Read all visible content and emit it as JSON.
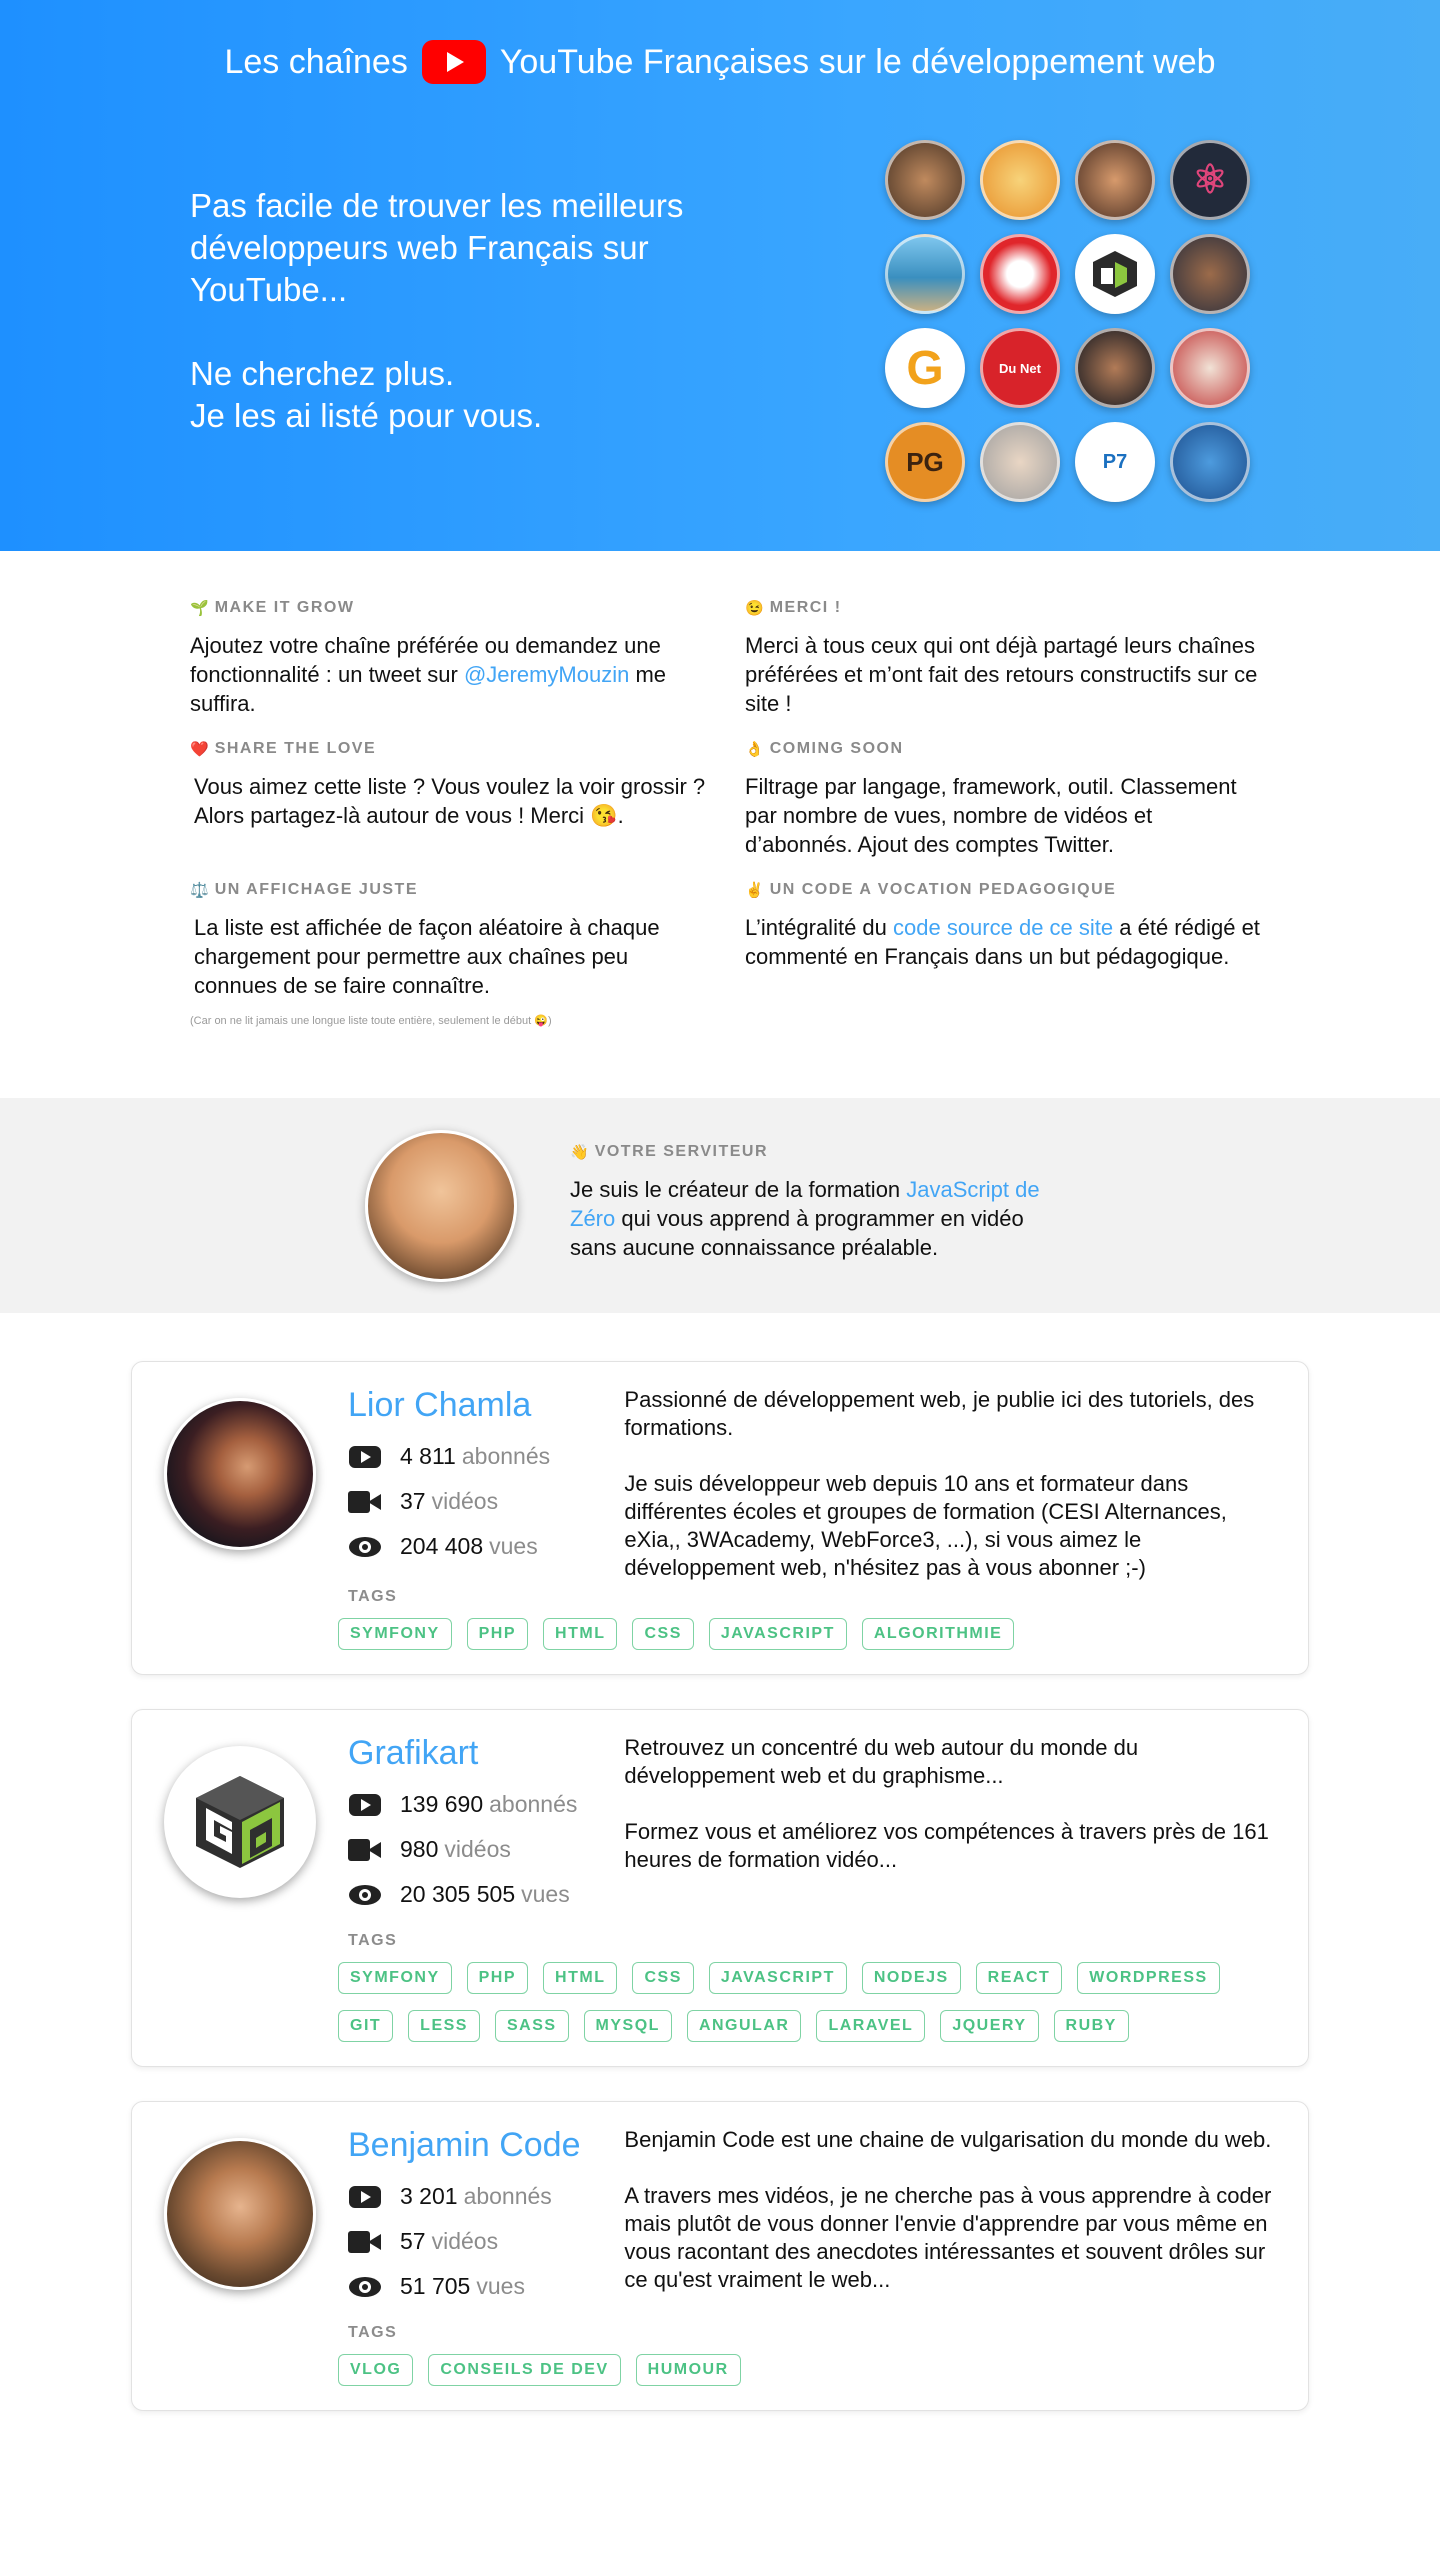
{
  "hero": {
    "title_before": "Les chaînes",
    "title_after": "YouTube Françaises sur le développement web",
    "text_1": "Pas facile de trouver les meilleurs développeurs web Français sur YouTube...",
    "text_2_line1": "Ne cherchez plus.",
    "text_2_line2": "Je les ai listé pour vous.",
    "avatars": [
      "LC",
      "Y",
      "BC",
      "React",
      "Voyage",
      "WC",
      "Grafikart",
      "Fam",
      "G",
      "Du Net",
      "DR",
      "Kid",
      "PG",
      "T",
      "PrimFX",
      "Z"
    ]
  },
  "info": {
    "grow": {
      "emoji": "🌱",
      "title": "MAKE IT GROW",
      "text_before": "Ajoutez votre chaîne préférée ou demandez une fonctionnalité : un tweet sur ",
      "link": "@JeremyMouzin",
      "text_after": " me suffira."
    },
    "merci": {
      "emoji": "😉",
      "title": "MERCI !",
      "text": "Merci à tous ceux qui ont déjà partagé leurs chaînes préférées et m’ont fait des retours constructifs sur ce site !"
    },
    "share": {
      "emoji": "❤️",
      "title": "SHARE THE LOVE",
      "text": "Vous aimez cette liste ? Vous voulez la voir grossir ? Alors partagez-là autour de vous ! Merci 😘."
    },
    "soon": {
      "emoji": "👌",
      "title": "COMING SOON",
      "text": "Filtrage par langage, framework, outil. Classement par nombre de vues, nombre de vidéos et d’abonnés. Ajout des comptes Twitter."
    },
    "fair": {
      "emoji": "⚖️",
      "title": "UN AFFICHAGE JUSTE",
      "text": "La liste est affichée de façon aléatoire à chaque chargement pour permettre aux chaînes peu connues de se faire connaître.",
      "note": "(Car on ne lit jamais une longue liste toute entière, seulement le début 😜)"
    },
    "code": {
      "emoji": "✌️",
      "title": "UN CODE A VOCATION PEDAGOGIQUE",
      "text_before": "L’intégralité du ",
      "link": "code source de ce site",
      "text_after": " a été rédigé et commenté en Français dans un but pédagogique."
    }
  },
  "servant": {
    "emoji": "👋",
    "title": "VOTRE SERVITEUR",
    "text_before": "Je suis le créateur de la formation ",
    "link": "JavaScript de Zéro",
    "text_after": " qui vous apprend à programmer en vidéo sans aucune connaissance préalable."
  },
  "labels": {
    "subscribers": "abonnés",
    "videos": "vidéos",
    "views": "vues",
    "tags": "TAGS"
  },
  "channels": [
    {
      "name": "Lior Chamla",
      "subscribers": "4 811",
      "videos": "37",
      "views": "204 408",
      "desc_1": "Passionné de développement web, je publie ici des tutoriels, des formations.",
      "desc_2": "Je suis développeur web depuis 10 ans et formateur dans différentes écoles et groupes de formation (CESI Alternances, eXia,, 3WAcademy, WebForce3, ...), si vous aimez le développement web, n'hésitez pas à vous abonner ;-)",
      "tags": [
        "SYMFONY",
        "PHP",
        "HTML",
        "CSS",
        "JAVASCRIPT",
        "ALGORITHMIE"
      ]
    },
    {
      "name": "Grafikart",
      "subscribers": "139 690",
      "videos": "980",
      "views": "20 305 505",
      "desc_1": "Retrouvez un concentré du web autour du monde du développement web et du graphisme...",
      "desc_2": "Formez vous et améliorez vos compétences à travers près de 161 heures de formation vidéo...",
      "tags": [
        "SYMFONY",
        "PHP",
        "HTML",
        "CSS",
        "JAVASCRIPT",
        "NODEJS",
        "REACT",
        "WORDPRESS",
        "GIT",
        "LESS",
        "SASS",
        "MYSQL",
        "ANGULAR",
        "LARAVEL",
        "JQUERY",
        "RUBY"
      ]
    },
    {
      "name": "Benjamin Code",
      "subscribers": "3 201",
      "videos": "57",
      "views": "51 705",
      "desc_1": "Benjamin Code est une chaine de vulgarisation du monde du web.",
      "desc_2": "A travers mes vidéos, je ne cherche pas à vous apprendre à coder mais plutôt de vous donner l'envie d'apprendre par vous même en vous racontant des anecdotes intéressantes et souvent drôles sur ce qu'est vraiment le web...",
      "tags": [
        "VLOG",
        "CONSEILS DE DEV",
        "HUMOUR"
      ]
    }
  ],
  "colors": {
    "hero_start": "#1e90ff",
    "hero_end": "#48adf7",
    "link": "#42a5f5",
    "tag": "#4cc284",
    "youtube_red": "#ff0000"
  }
}
